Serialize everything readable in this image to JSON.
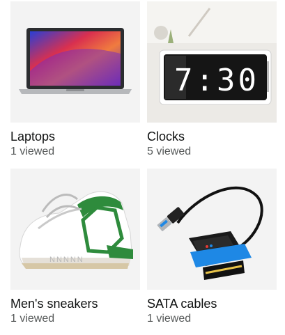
{
  "cards": [
    {
      "title": "Laptops",
      "viewed": "1 viewed",
      "icon": "laptop-image"
    },
    {
      "title": "Clocks",
      "viewed": "5 viewed",
      "icon": "clock-image",
      "clock_time": "7:30"
    },
    {
      "title": "Men's sneakers",
      "viewed": "1 viewed",
      "icon": "sneaker-image",
      "sneaker_text": "NNNNN"
    },
    {
      "title": "SATA cables",
      "viewed": "1 viewed",
      "icon": "sata-cable-image"
    }
  ],
  "colors": {
    "thumb_bg": "#f3f3f3",
    "text": "#0f1111",
    "muted": "#565959",
    "sneaker_green": "#2e8b3c",
    "cable_blue": "#1e88e5"
  }
}
